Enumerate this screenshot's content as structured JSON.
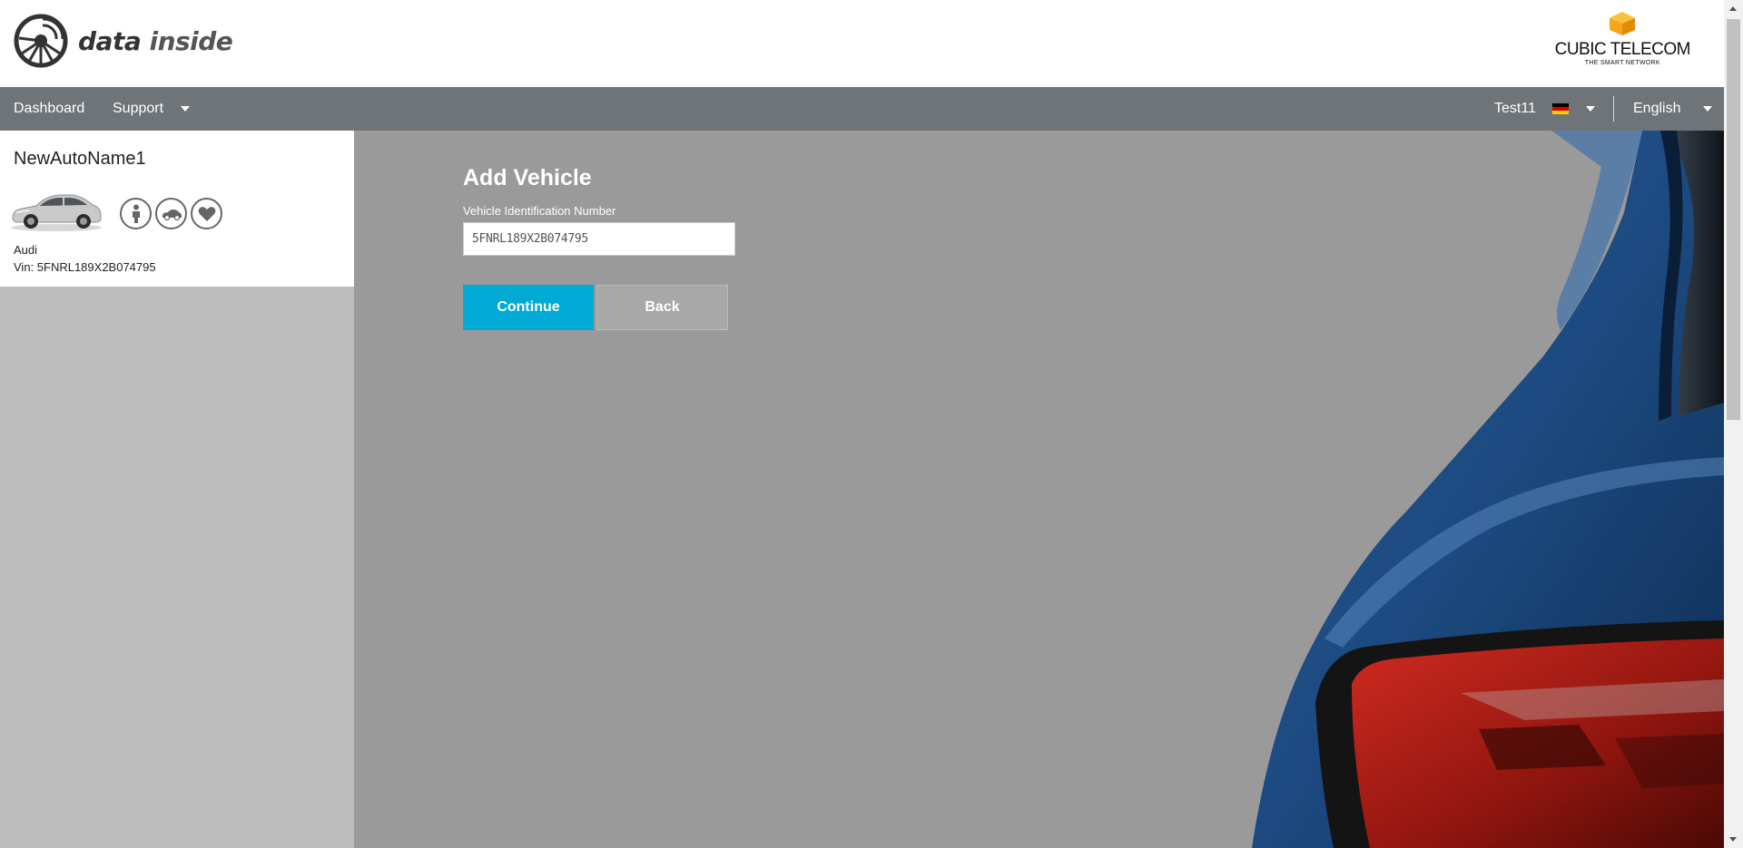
{
  "header": {
    "logo_text_1": "data",
    "logo_text_2": "inside",
    "partner_name": "CUBIC TELECOM",
    "partner_tagline": "THE SMART NETWORK"
  },
  "navbar": {
    "dashboard": "Dashboard",
    "support": "Support",
    "user": "Test11",
    "language": "English"
  },
  "sidebar": {
    "vehicle_name": "NewAutoName1",
    "make": "Audi",
    "vin": "Vin: 5FNRL189X2B074795",
    "status_icons": [
      "person-icon",
      "car-icon",
      "heart-icon"
    ]
  },
  "form": {
    "title": "Add Vehicle",
    "vin_label": "Vehicle Identification Number",
    "vin_value": "5FNRL189X2B074795",
    "continue_label": "Continue",
    "back_label": "Back"
  },
  "colors": {
    "navbar": "#6e7478",
    "main_bg": "#9a9a9a",
    "sidebar_bg": "#bdbdbd",
    "continue_btn": "#00aad4",
    "back_btn": "#a8a8a8"
  }
}
